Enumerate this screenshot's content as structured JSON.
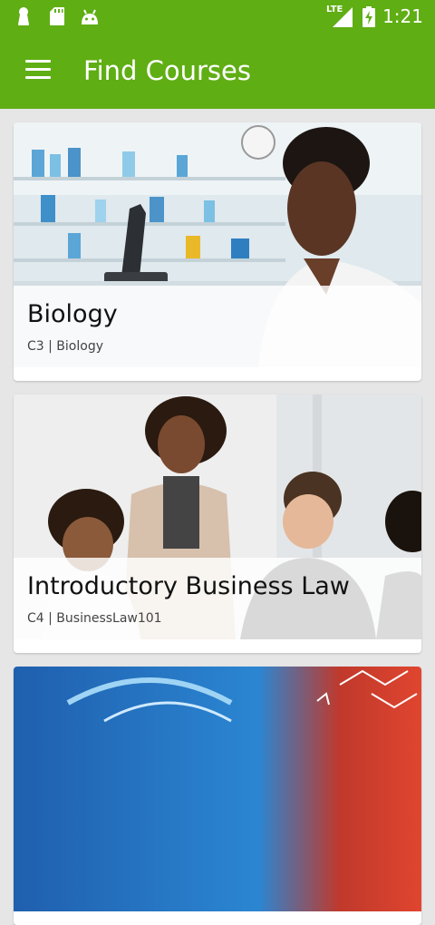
{
  "status_bar": {
    "time": "1:21",
    "network": "LTE",
    "icons": [
      "keyhole-icon",
      "sd-card-icon",
      "android-icon",
      "signal-icon",
      "battery-icon"
    ]
  },
  "app_bar": {
    "title": "Find Courses",
    "menu_icon": "menu-icon"
  },
  "courses": [
    {
      "title": "Biology",
      "subtitle": "C3 | Biology",
      "image": "laboratory-photo"
    },
    {
      "title": "Introductory Business Law",
      "subtitle": "C4 | BusinessLaw101",
      "image": "business-meeting-photo"
    },
    {
      "title": "",
      "subtitle": "",
      "image": "chemistry-photo"
    }
  ],
  "colors": {
    "primary": "#5fae14",
    "background": "#e6e6e6",
    "card": "#ffffff"
  }
}
